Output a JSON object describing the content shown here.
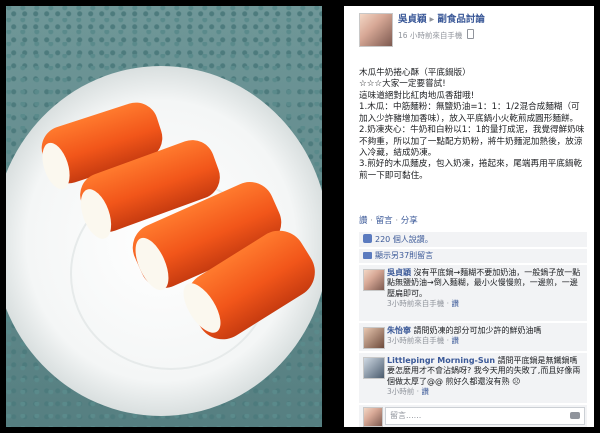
{
  "post": {
    "author": "吳貞穎",
    "arrow": "▸",
    "group": "副食品討論",
    "meta": "16 小時前來自手機",
    "title_line": "木瓜牛奶捲心酥（平底鍋版）",
    "line2": "☆☆☆大家一定要嘗試!",
    "line3": "這味道絕對比紅肉地瓜香甜哦!",
    "step1": "1.木瓜：中筋麵粉：無鹽奶油=1：1：1/2混合成麵糊（可加入少許豬增加香味），放入平底鍋小火乾煎成圓形麵餅。",
    "step2": "2.奶凍夾心：牛奶和白粉以1：1的量打成泥，我覺得鮮奶味不夠重，所以加了一點配方奶粉，將牛奶麵泥加熱後，放涼入冷藏，結成奶凍。",
    "step3": "3.煎好的木瓜麵皮，包入奶凍，捲起來，尾端再用平底鍋乾煎一下即可黏住。"
  },
  "actions": {
    "like": "讚",
    "comment": "留言",
    "share": "分享",
    "sep": "·"
  },
  "likes": {
    "text": "220 個人說讚。",
    "view_more": "顯示另37則留言"
  },
  "comments": [
    {
      "name": "吳貞穎",
      "text": "沒有平底鍋→麵糊不要加奶油，一般鍋子放一點點無鹽奶油→倒入麵糊，最小火慢慢煎，一邊煎，一邊壓扁即可。",
      "meta": "3小時前來自手機",
      "like": "讚"
    },
    {
      "name": "朱怡寧",
      "text": "請問奶凍的部分可加少許的鮮奶油嗎",
      "meta": "3小時前來自手機",
      "like": "讚"
    },
    {
      "name": "Littlepingr Morning-Sun",
      "text": "請問平底鍋是無鐵鍋嗎要怎麼用才不會沾鍋呀? 我今天用的失敗了,而且好像兩個做太厚了@@ 煎好久都還沒有熟",
      "emoji": "☹",
      "meta": "3小時前",
      "like": "讚"
    }
  ],
  "composer": {
    "placeholder": "留言......"
  },
  "colors": {
    "link": "#3b5998",
    "panel_bg": "#ffffff",
    "comment_bg": "#f2f3f5"
  }
}
